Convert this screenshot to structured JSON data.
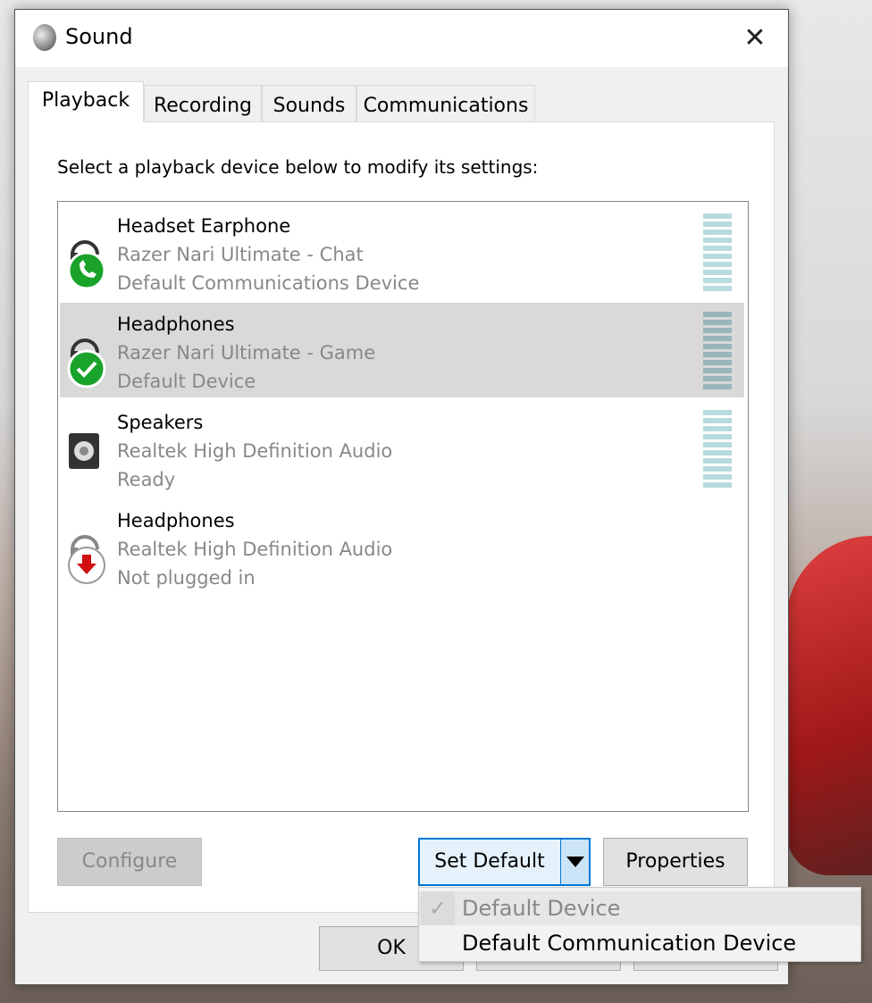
{
  "window": {
    "title": "Sound",
    "close": "✕"
  },
  "tabs": [
    "Playback",
    "Recording",
    "Sounds",
    "Communications"
  ],
  "instruction": "Select a playback device below to modify its settings:",
  "devices": [
    {
      "name": "Headset Earphone",
      "driver": "Razer Nari Ultimate - Chat",
      "status": "Default Communications Device",
      "badge": "phone",
      "selected": false
    },
    {
      "name": "Headphones",
      "driver": "Razer Nari Ultimate - Game",
      "status": "Default Device",
      "badge": "check",
      "selected": true
    },
    {
      "name": "Speakers",
      "driver": "Realtek High Definition Audio",
      "status": "Ready",
      "badge": "none",
      "selected": false
    },
    {
      "name": "Headphones",
      "driver": "Realtek High Definition Audio",
      "status": "Not plugged in",
      "badge": "unplugged",
      "selected": false
    }
  ],
  "buttons": {
    "configure": "Configure",
    "set_default": "Set Default",
    "properties": "Properties",
    "ok": "OK"
  },
  "menu": {
    "items": [
      {
        "label": "Default Device",
        "checked": true,
        "disabled": true
      },
      {
        "label": "Default Communication Device",
        "checked": false,
        "disabled": false
      }
    ],
    "check": "✓"
  },
  "colors": {
    "accent": "#0078d7",
    "green": "#1aa32a",
    "red": "#d01010"
  }
}
